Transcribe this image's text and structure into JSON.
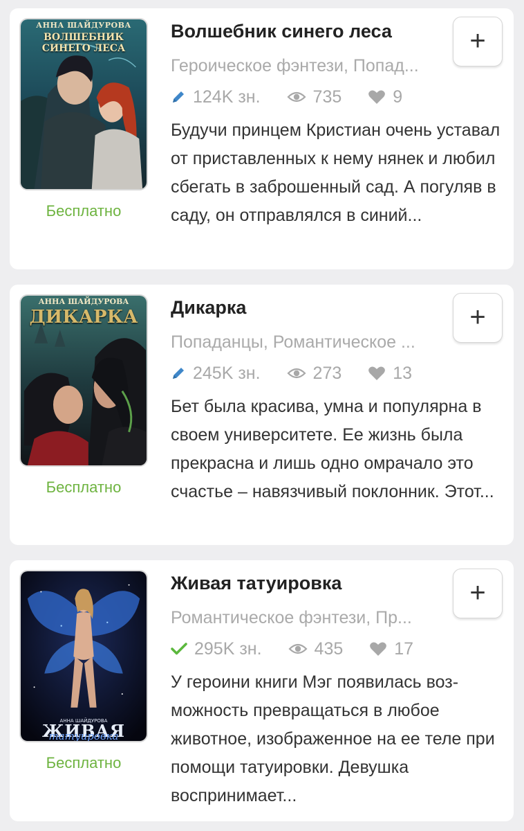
{
  "books": [
    {
      "cover_author": "АННА ШАЙДУРОВА",
      "cover_title": "ВОЛШЕБНИК СИНЕГО ЛЕСА",
      "title": "Волшебник синего леса",
      "genres": "Героическое фэнтези, Попад...",
      "chars": "124K зн.",
      "chars_icon": "pencil-icon",
      "views": "735",
      "likes": "9",
      "description": "Будучи принцем Кристиан очень уставал от приставленных к нему ня­нек и любил сбегать в заброшенный сад. А погуляв в саду, он отправ­лялся в синий...",
      "price": "Бесплатно",
      "add_label": "+"
    },
    {
      "cover_author": "АННА ШАЙДУРОВА",
      "cover_title": "ДИКАРКА",
      "title": "Дикарка",
      "genres": "Попаданцы, Романтическое ...",
      "chars": "245K зн.",
      "chars_icon": "pencil-icon",
      "views": "273",
      "likes": "13",
      "description": "Бет была красива, умна и популярна в своем университете. Ее жизнь была прекрасна и лишь одно омра­чало это счастье – навязчивый по­клонник. Этот...",
      "price": "Бесплатно",
      "add_label": "+"
    },
    {
      "cover_author": "АННА ШАЙДУРОВА",
      "cover_title": "ЖИВАЯ",
      "cover_subtitle": "татуировка",
      "title": "Живая татуировка",
      "genres": "Романтическое фэнтези, Пр...",
      "chars": "295K зн.",
      "chars_icon": "check-icon",
      "views": "435",
      "likes": "17",
      "description": "У героини книги Мэг появилась воз­можность превращаться в любое животное, изображенное на ее теле при помощи татуировки. Девушка воспринимает...",
      "price": "Бесплатно",
      "add_label": "+"
    }
  ],
  "colors": {
    "background": "#eeeef0",
    "card": "#ffffff",
    "price_green": "#6db33f",
    "pencil_blue": "#3f87c9",
    "check_green": "#5bb83d",
    "muted": "#a8a8a8"
  }
}
